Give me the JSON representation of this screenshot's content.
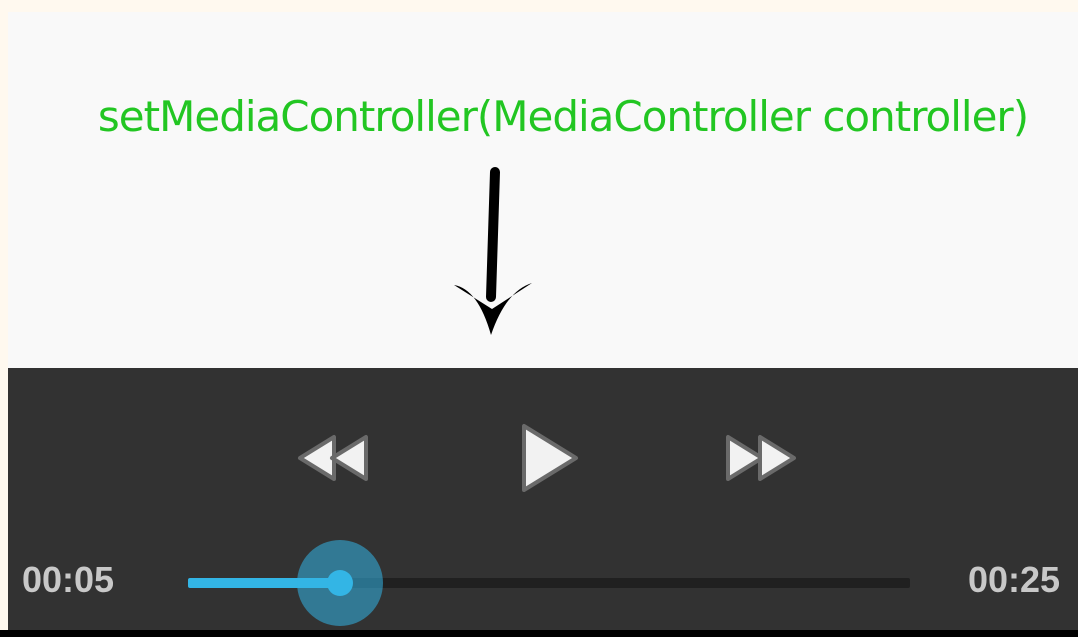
{
  "annotation": {
    "method_signature": "setMediaController(MediaController controller)",
    "text_color": "#22c622",
    "arrow_icon": "down-arrow-icon"
  },
  "media_controller": {
    "background": "#323232",
    "accent": "#33b5e5",
    "buttons": {
      "rewind_icon": "rewind-icon",
      "play_icon": "play-icon",
      "fast_forward_icon": "fast-forward-icon"
    },
    "current_time": "00:05",
    "total_time": "00:25",
    "progress": 0.21
  }
}
